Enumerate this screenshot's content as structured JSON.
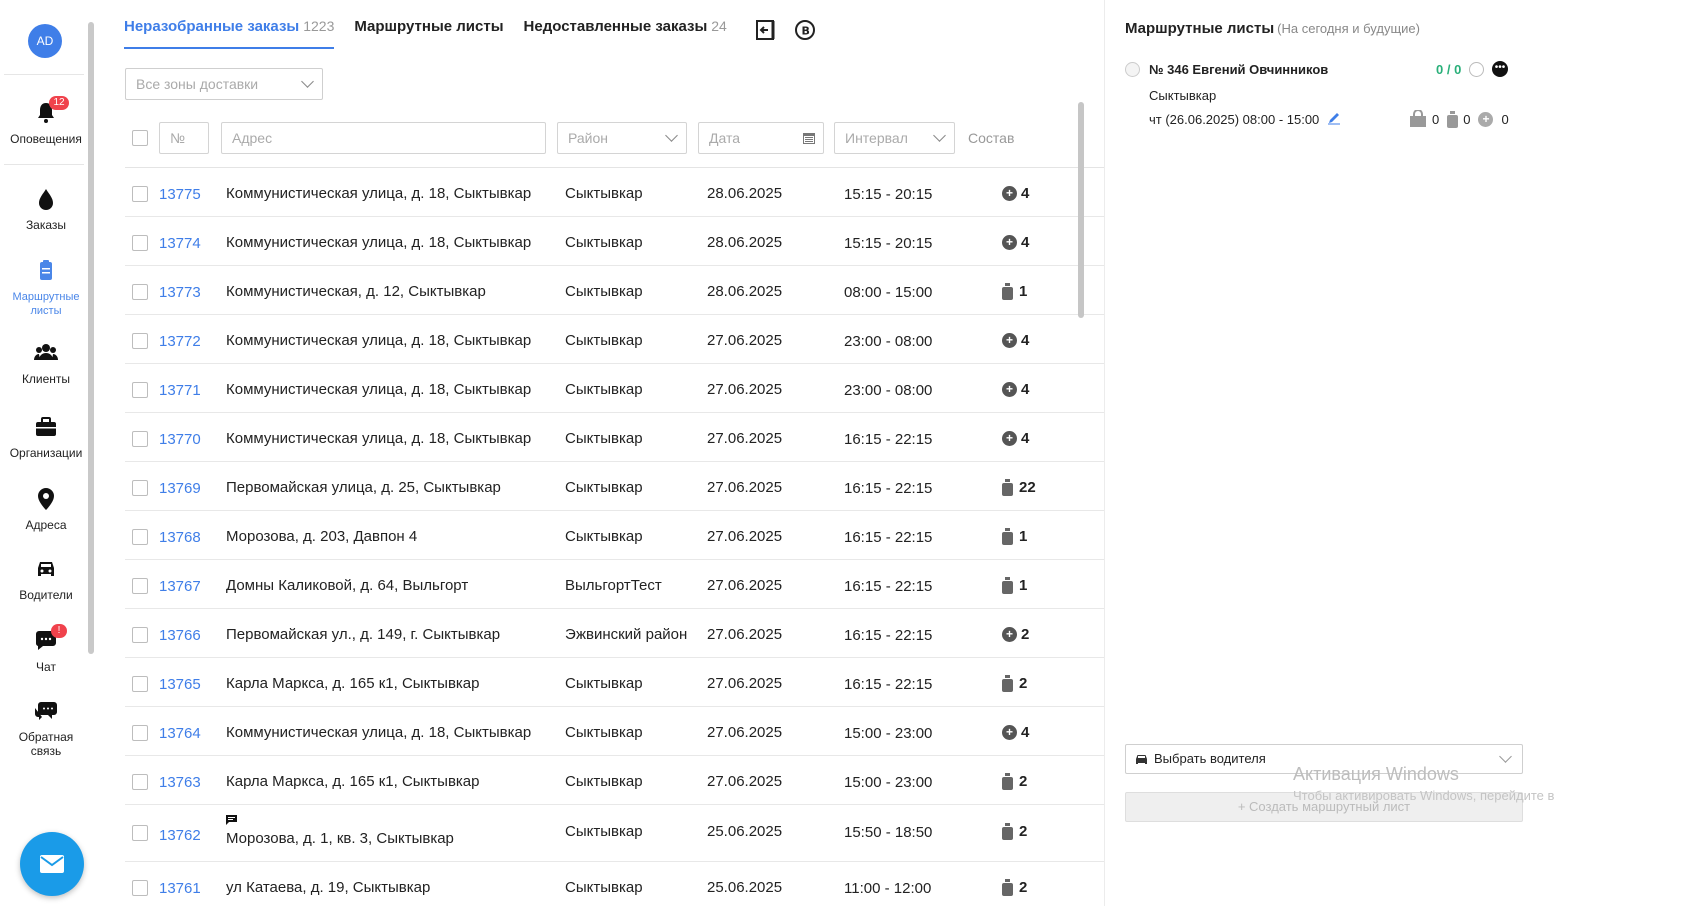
{
  "sidebar": {
    "avatar": "AD",
    "items": [
      {
        "label": "Оповещения",
        "badge": "12"
      },
      {
        "label": "Заказы"
      },
      {
        "label": "Маршрутные\nлисты"
      },
      {
        "label": "Клиенты"
      },
      {
        "label": "Организации"
      },
      {
        "label": "Адреса"
      },
      {
        "label": "Водители"
      },
      {
        "label": "Чат",
        "badge": "!"
      },
      {
        "label": "Обратная\nсвязь"
      }
    ]
  },
  "tabs": [
    {
      "label": "Неразобранные заказы",
      "count": "1223"
    },
    {
      "label": "Маршрутные листы",
      "count": ""
    },
    {
      "label": "Недоставленные заказы",
      "count": "24"
    }
  ],
  "filters": {
    "zone": "Все зоны доставки",
    "num_placeholder": "№",
    "addr_placeholder": "Адрес",
    "district": "Район",
    "date": "Дата",
    "interval": "Интервал",
    "sostav": "Состав"
  },
  "orders": [
    {
      "num": "13775",
      "addr": "Коммунистическая улица, д. 18, Сыктывкар",
      "district": "Сыктывкар",
      "date": "28.06.2025",
      "interval": "15:15 - 20:15",
      "icon": "plus",
      "qty": "4"
    },
    {
      "num": "13774",
      "addr": "Коммунистическая улица, д. 18, Сыктывкар",
      "district": "Сыктывкар",
      "date": "28.06.2025",
      "interval": "15:15 - 20:15",
      "icon": "plus",
      "qty": "4"
    },
    {
      "num": "13773",
      "addr": "Коммунистическая, д. 12, Сыктывкар",
      "district": "Сыктывкар",
      "date": "28.06.2025",
      "interval": "08:00 - 15:00",
      "icon": "bottle",
      "qty": "1"
    },
    {
      "num": "13772",
      "addr": "Коммунистическая улица, д. 18, Сыктывкар",
      "district": "Сыктывкар",
      "date": "27.06.2025",
      "interval": "23:00 - 08:00",
      "icon": "plus",
      "qty": "4"
    },
    {
      "num": "13771",
      "addr": "Коммунистическая улица, д. 18, Сыктывкар",
      "district": "Сыктывкар",
      "date": "27.06.2025",
      "interval": "23:00 - 08:00",
      "icon": "plus",
      "qty": "4"
    },
    {
      "num": "13770",
      "addr": "Коммунистическая улица, д. 18, Сыктывкар",
      "district": "Сыктывкар",
      "date": "27.06.2025",
      "interval": "16:15 - 22:15",
      "icon": "plus",
      "qty": "4"
    },
    {
      "num": "13769",
      "addr": "Первомайская улица, д. 25, Сыктывкар",
      "district": "Сыктывкар",
      "date": "27.06.2025",
      "interval": "16:15 - 22:15",
      "icon": "bottle",
      "qty": "22"
    },
    {
      "num": "13768",
      "addr": "Морозова, д. 203, Давпон 4",
      "district": "Сыктывкар",
      "date": "27.06.2025",
      "interval": "16:15 - 22:15",
      "icon": "bottle",
      "qty": "1"
    },
    {
      "num": "13767",
      "addr": "Домны Каликовой, д. 64, Выльгорт",
      "district": "ВыльгортТест",
      "date": "27.06.2025",
      "interval": "16:15 - 22:15",
      "icon": "bottle",
      "qty": "1"
    },
    {
      "num": "13766",
      "addr": "Первомайская ул., д. 149, г. Сыктывкар",
      "district": "Эжвинский район",
      "date": "27.06.2025",
      "interval": "16:15 - 22:15",
      "icon": "plus",
      "qty": "2"
    },
    {
      "num": "13765",
      "addr": "Карла Маркса, д. 165 к1, Сыктывкар",
      "district": "Сыктывкар",
      "date": "27.06.2025",
      "interval": "16:15 - 22:15",
      "icon": "bottle",
      "qty": "2"
    },
    {
      "num": "13764",
      "addr": "Коммунистическая улица, д. 18, Сыктывкар",
      "district": "Сыктывкар",
      "date": "27.06.2025",
      "interval": "15:00 - 23:00",
      "icon": "plus",
      "qty": "4"
    },
    {
      "num": "13763",
      "addr": "Карла Маркса, д. 165 к1, Сыктывкар",
      "district": "Сыктывкар",
      "date": "27.06.2025",
      "interval": "15:00 - 23:00",
      "icon": "bottle",
      "qty": "2"
    },
    {
      "num": "13762",
      "addr": "Морозова, д. 1, кв. 3, Сыктывкар",
      "district": "Сыктывкар",
      "date": "25.06.2025",
      "interval": "15:50 - 18:50",
      "icon": "bottle",
      "qty": "2",
      "comment": true
    },
    {
      "num": "13761",
      "addr": "ул Катаева, д. 19, Сыктывкар",
      "district": "Сыктывкар",
      "date": "25.06.2025",
      "interval": "11:00 - 12:00",
      "icon": "bottle",
      "qty": "2"
    }
  ],
  "panel": {
    "title": "Маршрутные листы",
    "subtitle": "(На сегодня и будущие)",
    "route": {
      "name": "№ 346 Евгений Овчинников",
      "count": "0 / 0",
      "city": "Сыктывкар",
      "date": "чт (26.06.2025) 08:00 - 15:00",
      "stats": [
        "0",
        "0",
        "0"
      ]
    },
    "driver_select": "Выбрать водителя",
    "create_button": "+ Создать маршрутный лист",
    "watermark_title": "Активация Windows",
    "watermark_text": "Чтобы активировать Windows, перейдите в"
  },
  "colors": {
    "accent": "#3f7ee8",
    "count_green": "#2ab07a",
    "badge": "#f0424c",
    "fab": "#1a9be8"
  }
}
